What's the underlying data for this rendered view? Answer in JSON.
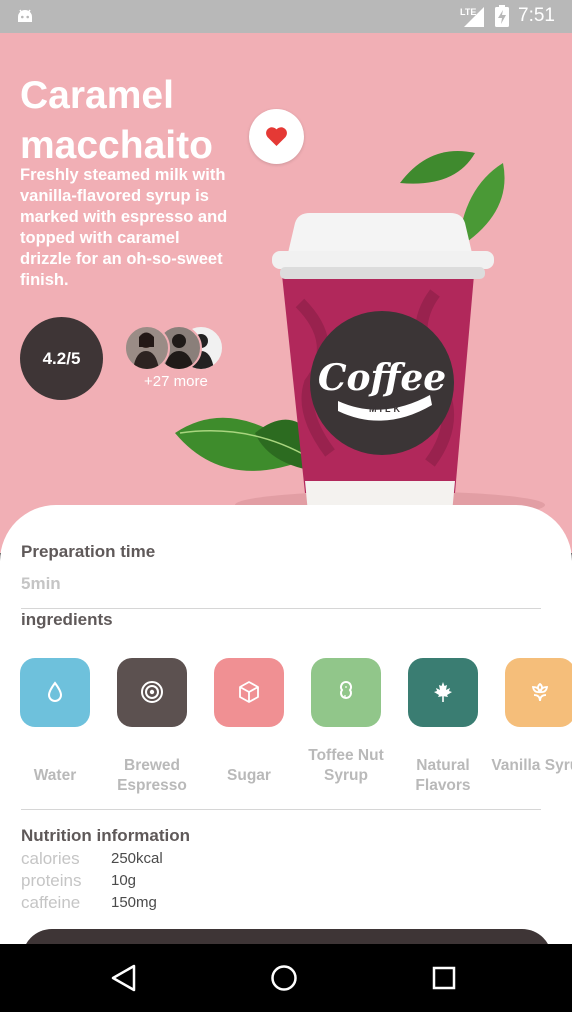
{
  "status_bar": {
    "network": "LTE",
    "time": "7:51"
  },
  "product": {
    "title_line1": "Caramel",
    "title_line2": "macchaito",
    "description": "Freshly steamed milk with vanilla-flavored syrup is marked with espresso and topped with caramel drizzle for an oh-so-sweet finish.",
    "rating": "4.2/5",
    "reviewers_more": "+27 more",
    "cup_logo_text": "Coffee",
    "cup_logo_sub": "MILK"
  },
  "preparation": {
    "label": "Preparation time",
    "value": "5min"
  },
  "ingredients": {
    "label": "ingredients",
    "items": [
      {
        "name": "Water",
        "color": "#6ec1dc",
        "icon": "water-drop-icon"
      },
      {
        "name": "Brewed Espresso",
        "color": "#5c5150",
        "icon": "target-icon"
      },
      {
        "name": "Sugar",
        "color": "#f09093",
        "icon": "cube-icon"
      },
      {
        "name": "Toffee Nut Syrup",
        "color": "#91c68a",
        "icon": "peanut-icon"
      },
      {
        "name": "Natural Flavors",
        "color": "#3a7d72",
        "icon": "maple-leaf-icon"
      },
      {
        "name": "Vanilla Syrup",
        "color": "#f5be7a",
        "icon": "flower-icon"
      }
    ]
  },
  "nutrition": {
    "label": "Nutrition information",
    "rows": [
      {
        "key": "calories",
        "value": "250kcal"
      },
      {
        "key": "proteins",
        "value": "10g"
      },
      {
        "key": "caffeine",
        "value": "150mg"
      }
    ]
  },
  "colors": {
    "hero_bg": "#f1afb5",
    "dark": "#3e3536",
    "heart": "#e53935"
  }
}
